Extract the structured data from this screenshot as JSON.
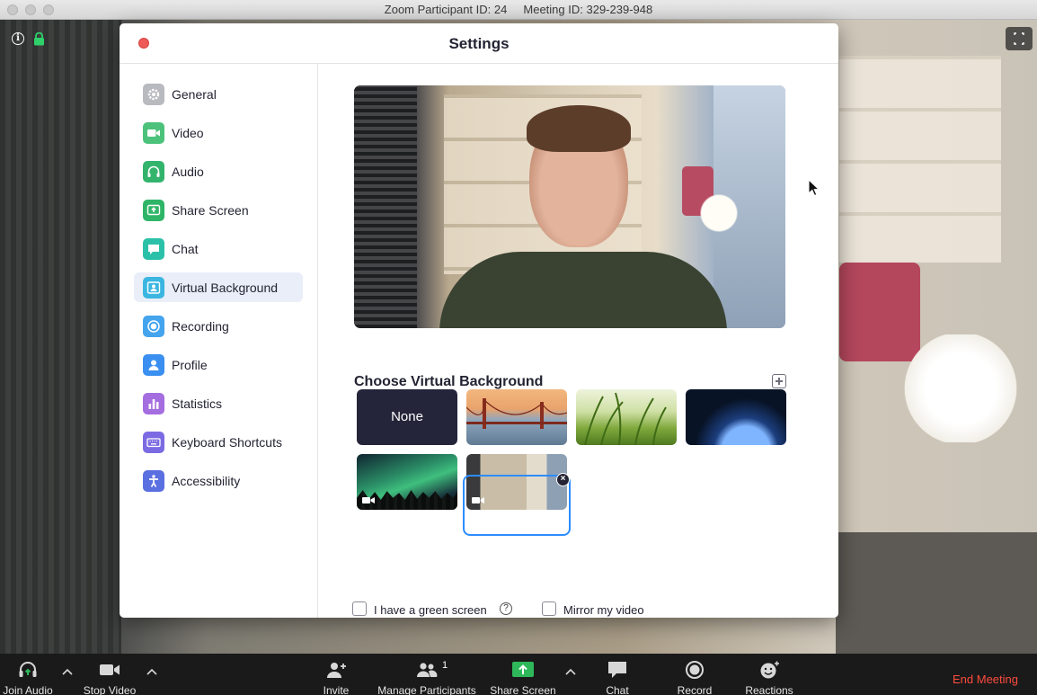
{
  "window": {
    "title": "Zoom Participant ID: 24     Meeting ID: 329-239-948"
  },
  "settings": {
    "title": "Settings",
    "nav": [
      {
        "label": "General",
        "icon": "gear-icon",
        "color": "#9a9aa5"
      },
      {
        "label": "Video",
        "icon": "video-camera-icon",
        "color": "#4cc27b"
      },
      {
        "label": "Audio",
        "icon": "headphones-icon",
        "color": "#33b46d"
      },
      {
        "label": "Share Screen",
        "icon": "share-screen-icon",
        "color": "#2fb567"
      },
      {
        "label": "Chat",
        "icon": "chat-bubble-icon",
        "color": "#2bc1a8"
      },
      {
        "label": "Virtual Background",
        "icon": "person-portrait-icon",
        "color": "#3ab6e0"
      },
      {
        "label": "Recording",
        "icon": "record-circle-icon",
        "color": "#44a4ee"
      },
      {
        "label": "Profile",
        "icon": "user-icon",
        "color": "#3a8ff0"
      },
      {
        "label": "Statistics",
        "icon": "bar-chart-icon",
        "color": "#a46de0"
      },
      {
        "label": "Keyboard Shortcuts",
        "icon": "keyboard-icon",
        "color": "#7b6be2"
      },
      {
        "label": "Accessibility",
        "icon": "accessibility-icon",
        "color": "#5a6fe0"
      }
    ],
    "active_item": "Virtual Background",
    "content": {
      "section_title": "Choose Virtual Background",
      "backgrounds": [
        {
          "label": "None",
          "kind": "none"
        },
        {
          "label": "",
          "kind": "bridge-image"
        },
        {
          "label": "",
          "kind": "grass-image"
        },
        {
          "label": "",
          "kind": "earth-space-image"
        },
        {
          "label": "",
          "kind": "aurora-video"
        },
        {
          "label": "",
          "kind": "office-video",
          "selected": true
        }
      ],
      "green_screen_label": "I have a green screen",
      "mirror_label": "Mirror my video",
      "green_screen_checked": false,
      "mirror_checked": false
    }
  },
  "toolbar": {
    "join_audio": "Join Audio",
    "stop_video": "Stop Video",
    "invite": "Invite",
    "manage_participants": "Manage Participants",
    "participant_count": "1",
    "share_screen": "Share Screen",
    "chat": "Chat",
    "record": "Record",
    "reactions": "Reactions",
    "end_meeting": "End Meeting"
  },
  "colors": {
    "accent": "#2d8cff",
    "share_green": "#2eb85a",
    "end_red": "#ff4b3e",
    "close_red": "#ed5a57"
  }
}
